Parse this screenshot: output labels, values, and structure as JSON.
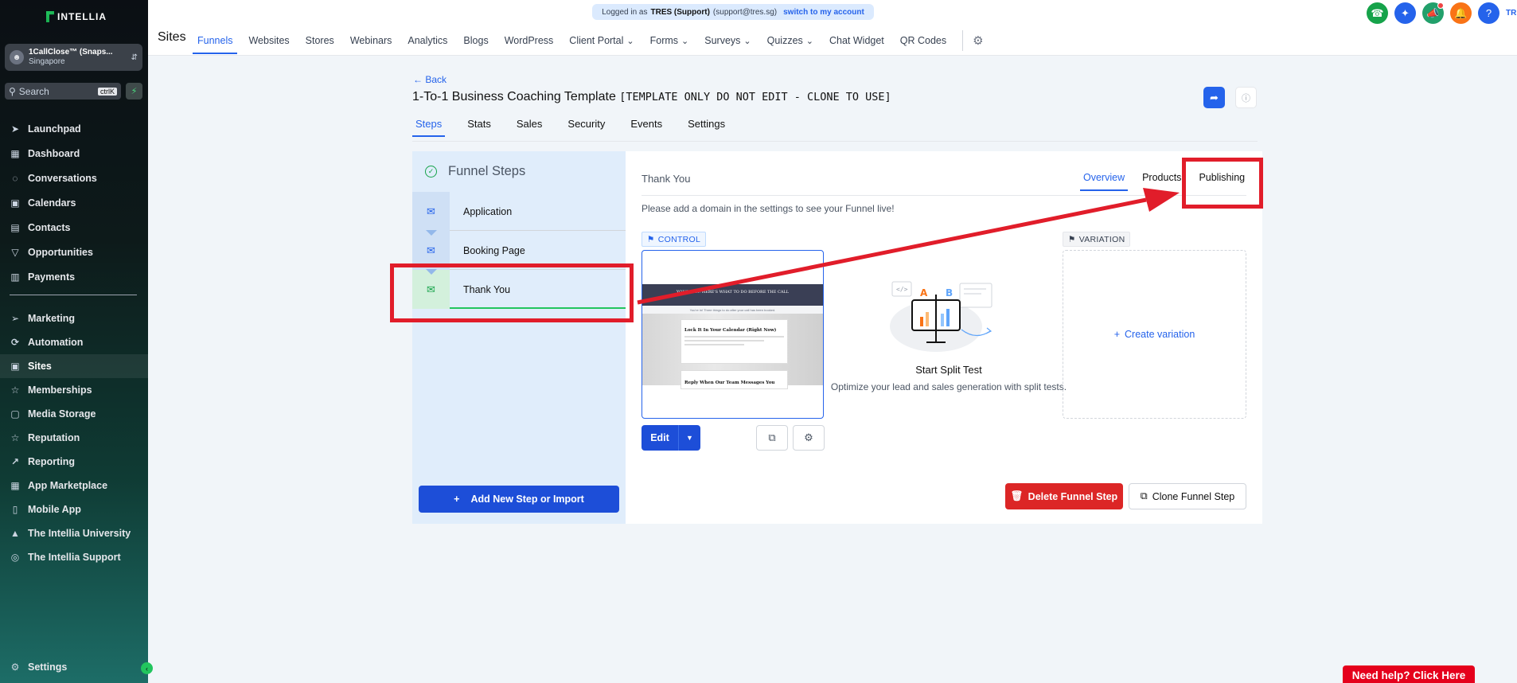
{
  "brand": {
    "name": "INTELLIA"
  },
  "account": {
    "name": "1CallClose™ (Snaps...",
    "location": "Singapore"
  },
  "search": {
    "placeholder": "Search",
    "shortcut": "ctrlK"
  },
  "sidebar": {
    "items": [
      {
        "label": "Launchpad",
        "icon": "rocket-icon"
      },
      {
        "label": "Dashboard",
        "icon": "grid-icon"
      },
      {
        "label": "Conversations",
        "icon": "chat-icon"
      },
      {
        "label": "Calendars",
        "icon": "calendar-icon"
      },
      {
        "label": "Contacts",
        "icon": "contacts-icon"
      },
      {
        "label": "Opportunities",
        "icon": "filter-icon"
      },
      {
        "label": "Payments",
        "icon": "payments-icon"
      },
      {
        "label": "Marketing",
        "icon": "send-icon"
      },
      {
        "label": "Automation",
        "icon": "automation-icon"
      },
      {
        "label": "Sites",
        "icon": "sites-icon",
        "active": true
      },
      {
        "label": "Memberships",
        "icon": "award-icon"
      },
      {
        "label": "Media Storage",
        "icon": "folder-icon"
      },
      {
        "label": "Reputation",
        "icon": "star-icon"
      },
      {
        "label": "Reporting",
        "icon": "trend-icon"
      },
      {
        "label": "App Marketplace",
        "icon": "apps-icon"
      },
      {
        "label": "Mobile App",
        "icon": "phone-icon"
      },
      {
        "label": "The Intellia University",
        "icon": "graduation-icon"
      },
      {
        "label": "The Intellia Support",
        "icon": "support-icon"
      }
    ],
    "settings_label": "Settings"
  },
  "banner": {
    "prefix": "Logged in as",
    "user": "TRES (Support)",
    "email": "(support@tres.sg)",
    "switch_label": "switch to my account"
  },
  "topbar": {
    "title": "Sites",
    "nav": [
      {
        "label": "Funnels",
        "active": true
      },
      {
        "label": "Websites"
      },
      {
        "label": "Stores"
      },
      {
        "label": "Webinars"
      },
      {
        "label": "Analytics"
      },
      {
        "label": "Blogs"
      },
      {
        "label": "WordPress"
      },
      {
        "label": "Client Portal",
        "dropdown": true
      },
      {
        "label": "Forms",
        "dropdown": true
      },
      {
        "label": "Surveys",
        "dropdown": true
      },
      {
        "label": "Quizzes",
        "dropdown": true
      },
      {
        "label": "Chat Widget"
      },
      {
        "label": "QR Codes"
      }
    ],
    "user_short": "TRES",
    "icon_colors": {
      "phone": "#16a34a",
      "spark": "#2563eb",
      "megaphone": "#22a06b",
      "bell": "#f97316",
      "help": "#2563eb"
    }
  },
  "page": {
    "back_label": "Back",
    "title": "1-To-1 Business Coaching Template",
    "title_note": "[TEMPLATE ONLY DO NOT EDIT - CLONE TO USE]",
    "tabs": [
      "Steps",
      "Stats",
      "Sales",
      "Security",
      "Events",
      "Settings"
    ]
  },
  "steps": {
    "heading": "Funnel Steps",
    "items": [
      "Application",
      "Booking Page",
      "Thank You"
    ],
    "add_label": "Add New Step or Import"
  },
  "detail": {
    "title": "Thank You",
    "tabs": [
      "Overview",
      "Products",
      "Publishing"
    ],
    "message": "Please add a domain in the settings to see your Funnel live!",
    "control_label": "CONTROL",
    "variation_label": "VARIATION",
    "create_variation": "Create variation",
    "split_title": "Start Split Test",
    "split_desc": "Optimize your lead and sales generation with split tests.",
    "edit_label": "Edit",
    "delete_label": "Delete Funnel Step",
    "clone_label": "Clone Funnel Step"
  },
  "preview": {
    "header_text": "YOU'RE IN! HERE'S WHAT TO DO BEFORE THE CALL",
    "sub_text": "You're in! Three things to do after your call has been booked.",
    "card1_title": "Lock It In Your Calendar (Right Now)",
    "card2_title": "Reply When Our Team Messages You"
  },
  "help_label": "Need help? Click Here",
  "colors": {
    "accent": "#2563eb",
    "annotation": "#e11d2a",
    "danger": "#dc2626"
  }
}
